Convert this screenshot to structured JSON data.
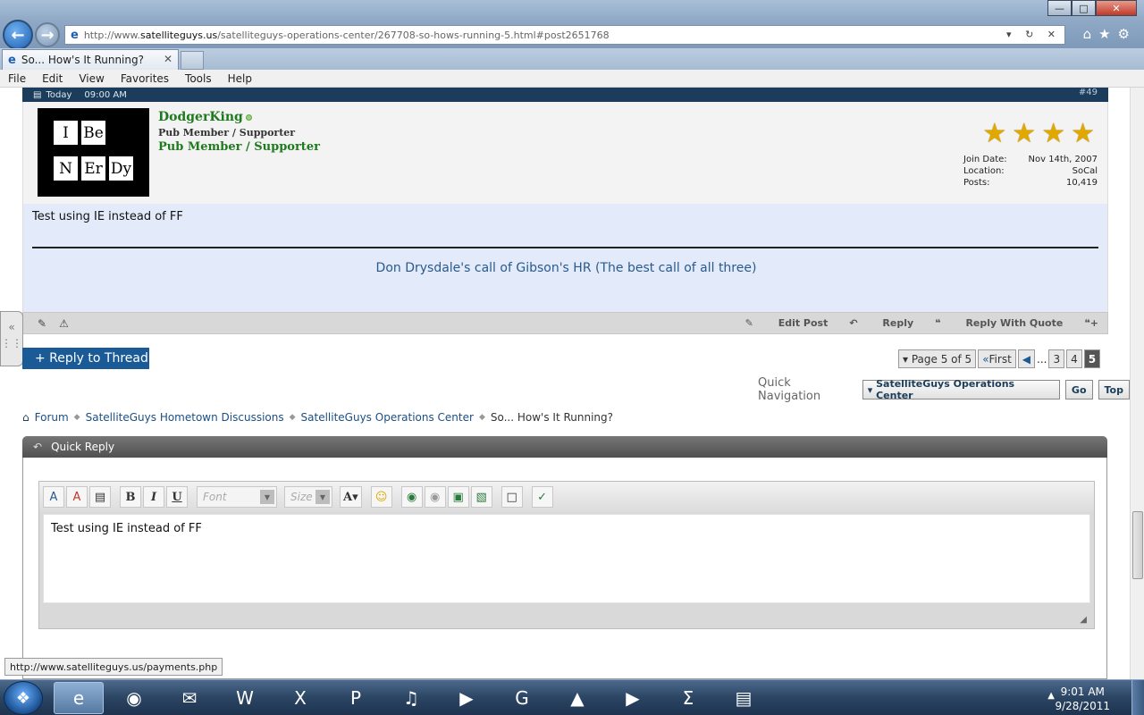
{
  "browser": {
    "url_prefix": "http://www.",
    "url_domain": "satelliteguys.us",
    "url_rest": "/satelliteguys-operations-center/267708-so-hows-running-5.html#post2651768",
    "tab_title": "So... How's It Running?",
    "menu": [
      "File",
      "Edit",
      "View",
      "Favorites",
      "Tools",
      "Help"
    ]
  },
  "post": {
    "date": "Today",
    "time": "09:00 AM",
    "number": "#49",
    "username": "DodgerKing",
    "user_title": "Pub Member / Supporter",
    "user_rank": "Pub Member / Supporter",
    "avatar_cells": [
      "I",
      "Be",
      "N",
      "Er",
      "Dy"
    ],
    "join_date_label": "Join Date:",
    "join_date": "Nov 14th, 2007",
    "location_label": "Location:",
    "location": "SoCal",
    "posts_label": "Posts:",
    "posts": "10,419",
    "star_count": 4,
    "message": "Test using IE instead of FF",
    "signature_link": "Don Drysdale's call of Gibson's HR (The best call of all three)",
    "actions": {
      "edit": "Edit Post",
      "reply": "Reply",
      "reply_quote": "Reply With Quote"
    }
  },
  "thread": {
    "reply_button": "+ Reply to Thread",
    "pager": {
      "label": "Page 5 of 5",
      "first": "First",
      "dots": "...",
      "pages": [
        "3",
        "4",
        "5"
      ],
      "current": "5"
    },
    "quick_nav_label": "Quick Navigation",
    "quick_nav_select": "SatelliteGuys Operations Center",
    "go": "Go",
    "top": "Top"
  },
  "breadcrumb": [
    "Forum",
    "SatelliteGuys Hometown Discussions",
    "SatelliteGuys Operations Center",
    "So... How's It Running?"
  ],
  "quick_reply": {
    "title": "Quick Reply",
    "font_placeholder": "Font",
    "size_placeholder": "Size",
    "text": "Test using IE instead of FF"
  },
  "status_url": "http://www.satelliteguys.us/payments.php",
  "clock": {
    "time": "9:01 AM",
    "date": "9/28/2011"
  }
}
